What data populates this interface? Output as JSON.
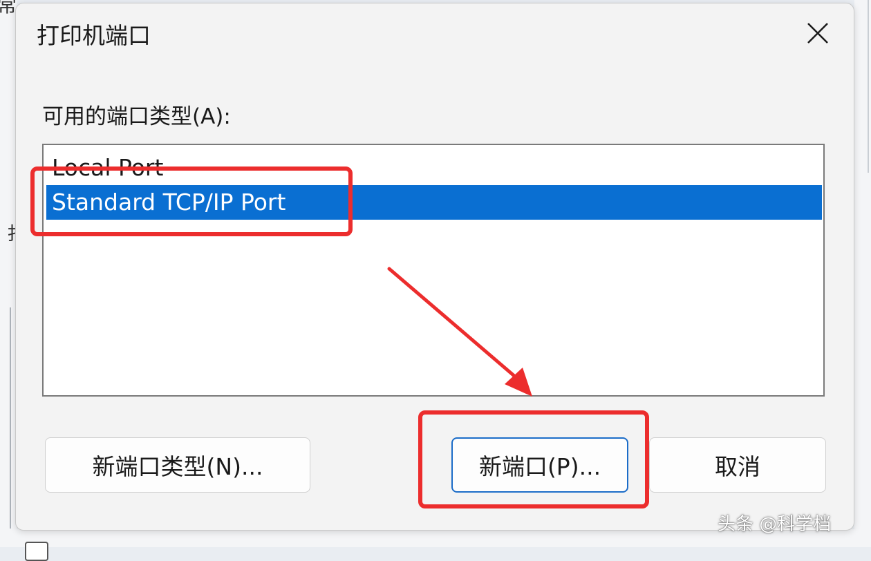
{
  "dialog": {
    "title": "打印机端口",
    "list_label": "可用的端口类型(A):",
    "port_types": [
      {
        "label": "Local Port",
        "selected": false
      },
      {
        "label": "Standard TCP/IP Port",
        "selected": true
      }
    ],
    "buttons": {
      "new_port_type": "新端口类型(N)...",
      "new_port": "新端口(P)...",
      "cancel": "取消"
    }
  },
  "colors": {
    "selection": "#0a6fd2",
    "annotation": "#ec2d2d",
    "default_button_border": "#1b6cc8"
  },
  "icons": {
    "close": "close-icon"
  },
  "watermark": "头条 @科学档"
}
